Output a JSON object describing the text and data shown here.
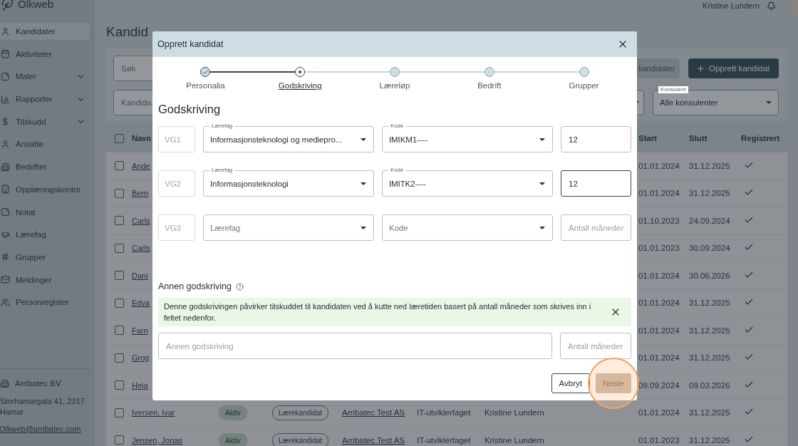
{
  "app": {
    "logo": "Olkweb",
    "user_name": "Kristine Lundern"
  },
  "sidebar": {
    "items": [
      {
        "label": "Kandidater",
        "selected": true,
        "has_submenu": false
      },
      {
        "label": "Aktiviteter",
        "selected": false,
        "has_submenu": false
      },
      {
        "label": "Maler",
        "selected": false,
        "has_submenu": true
      },
      {
        "label": "Rapporter",
        "selected": false,
        "has_submenu": true
      },
      {
        "label": "Tilskudd",
        "selected": false,
        "has_submenu": true
      },
      {
        "label": "Ansatte",
        "selected": false,
        "has_submenu": false
      },
      {
        "label": "Bedrifter",
        "selected": false,
        "has_submenu": false
      },
      {
        "label": "Opplæringskontor",
        "selected": false,
        "has_submenu": false
      },
      {
        "label": "Notat",
        "selected": false,
        "has_submenu": false
      },
      {
        "label": "Lærefag",
        "selected": false,
        "has_submenu": false
      },
      {
        "label": "Grupper",
        "selected": false,
        "has_submenu": false
      },
      {
        "label": "Meldinger",
        "selected": false,
        "has_submenu": false
      },
      {
        "label": "Personregister",
        "selected": false,
        "has_submenu": false
      }
    ],
    "org": {
      "name": "Arribatec BV",
      "address": "Storhamargata 41, 2317 Hamar",
      "email": "Olkweb@arribatec.com"
    }
  },
  "page": {
    "title": "Kandid",
    "search": {
      "placeholder": "Søk"
    },
    "candidate_filter": {
      "placeholder": "Kandida"
    },
    "export_button": "kandidater",
    "create_button": "Opprett kandidat",
    "consultant_filter": {
      "label": "Konsulent",
      "value": "Alle konsulenter"
    }
  },
  "table": {
    "header": {
      "checked": false,
      "name": "Navn",
      "start": "Start",
      "end": "Slutt",
      "registered": "Registrert"
    },
    "rows": [
      {
        "checked": false,
        "name": "Ande",
        "start": "01.01.2024",
        "end": "31.12.2025",
        "registered": true
      },
      {
        "checked": false,
        "name": "Bern",
        "start": "01.01.2024",
        "end": "31.12.2025",
        "registered": true
      },
      {
        "checked": false,
        "name": "Carls",
        "start": "01.10.2023",
        "end": "24.09.2024",
        "registered": true
      },
      {
        "checked": false,
        "name": "Carls",
        "start": "01.01.2023",
        "end": "30.09.2024",
        "registered": true
      },
      {
        "checked": false,
        "name": "Dani",
        "start": "01.01.2024",
        "end": "30.06.2026",
        "registered": true
      },
      {
        "checked": false,
        "name": "Edva",
        "start": "01.01.2024",
        "end": "31.12.2025",
        "registered": true
      },
      {
        "checked": false,
        "name": "Farn",
        "start": "01.01.2024",
        "end": "31.12.2025",
        "registered": true
      },
      {
        "checked": false,
        "name": "Grog",
        "start": "01.01.2024",
        "end": "31.12.2025",
        "registered": true
      },
      {
        "checked": false,
        "name": "Heia",
        "start": "09.09.2024",
        "end": "09.03.2026",
        "registered": true
      },
      {
        "checked": false,
        "name": "Iversen, Ivar",
        "status": "Aktiv",
        "type": "Lærekandidat",
        "company": "Arribatec Test AS",
        "subject": "IT-utviklerfaget",
        "consultant": "Kristine Lundern",
        "start": "01.01.2024",
        "end": "31.12.2025",
        "registered": true
      },
      {
        "checked": false,
        "name": "Jensen, Jonas",
        "status": "Aktiv",
        "type": "Lærekandidat",
        "company": "Arribatec Test AS",
        "subject": "IT-utviklerfaget",
        "consultant": "Kristine Lundern",
        "start": "01.01.2023",
        "end": "31.12.2025",
        "registered": true
      }
    ]
  },
  "dialog": {
    "title": "Opprett kandidat",
    "steps": [
      {
        "label": "Personalia",
        "completed": true,
        "selected": false
      },
      {
        "label": "Godskriving",
        "completed": false,
        "selected": true
      },
      {
        "label": "Læreløp",
        "completed": false,
        "selected": false
      },
      {
        "label": "Bedrift",
        "completed": false,
        "selected": false
      },
      {
        "label": "Grupper",
        "completed": false,
        "selected": false
      }
    ],
    "heading": "Godskriving",
    "credit_rows": [
      {
        "level_label": "VG1",
        "subject": {
          "label": "Lærefag",
          "value": "Informasjonsteknologi og mediepro..."
        },
        "code": {
          "label": "Kode",
          "value": "IMIKM1----"
        },
        "months": {
          "value": "12",
          "focused": false
        }
      },
      {
        "level_label": "VG2",
        "subject": {
          "label": "Lærefag",
          "value": "Informasjonsteknologi"
        },
        "code": {
          "label": "Kode",
          "value": "IMITK2----"
        },
        "months": {
          "value": "12",
          "focused": true
        }
      },
      {
        "level_label": "VG3",
        "subject": {
          "placeholder": "Lærefag"
        },
        "code": {
          "placeholder": "Kode"
        },
        "months": {
          "placeholder": "Antall måneder",
          "focused": false
        }
      }
    ],
    "other_heading": "Annen godskriving",
    "info": "Denne godskrivingen påvirker tilskuddet til kandidaten ved å kutte ned læretiden basert på antall måneder som skrives inn i feltet nedenfor.",
    "other_field": {
      "placeholder": "Annen godskriving"
    },
    "other_months": {
      "placeholder": "Antall måneder"
    },
    "buttons": [
      {
        "label": "Avbryt",
        "kind": "secondary",
        "disabled": false
      },
      {
        "label": "Neste",
        "kind": "primary",
        "disabled": true
      }
    ]
  }
}
